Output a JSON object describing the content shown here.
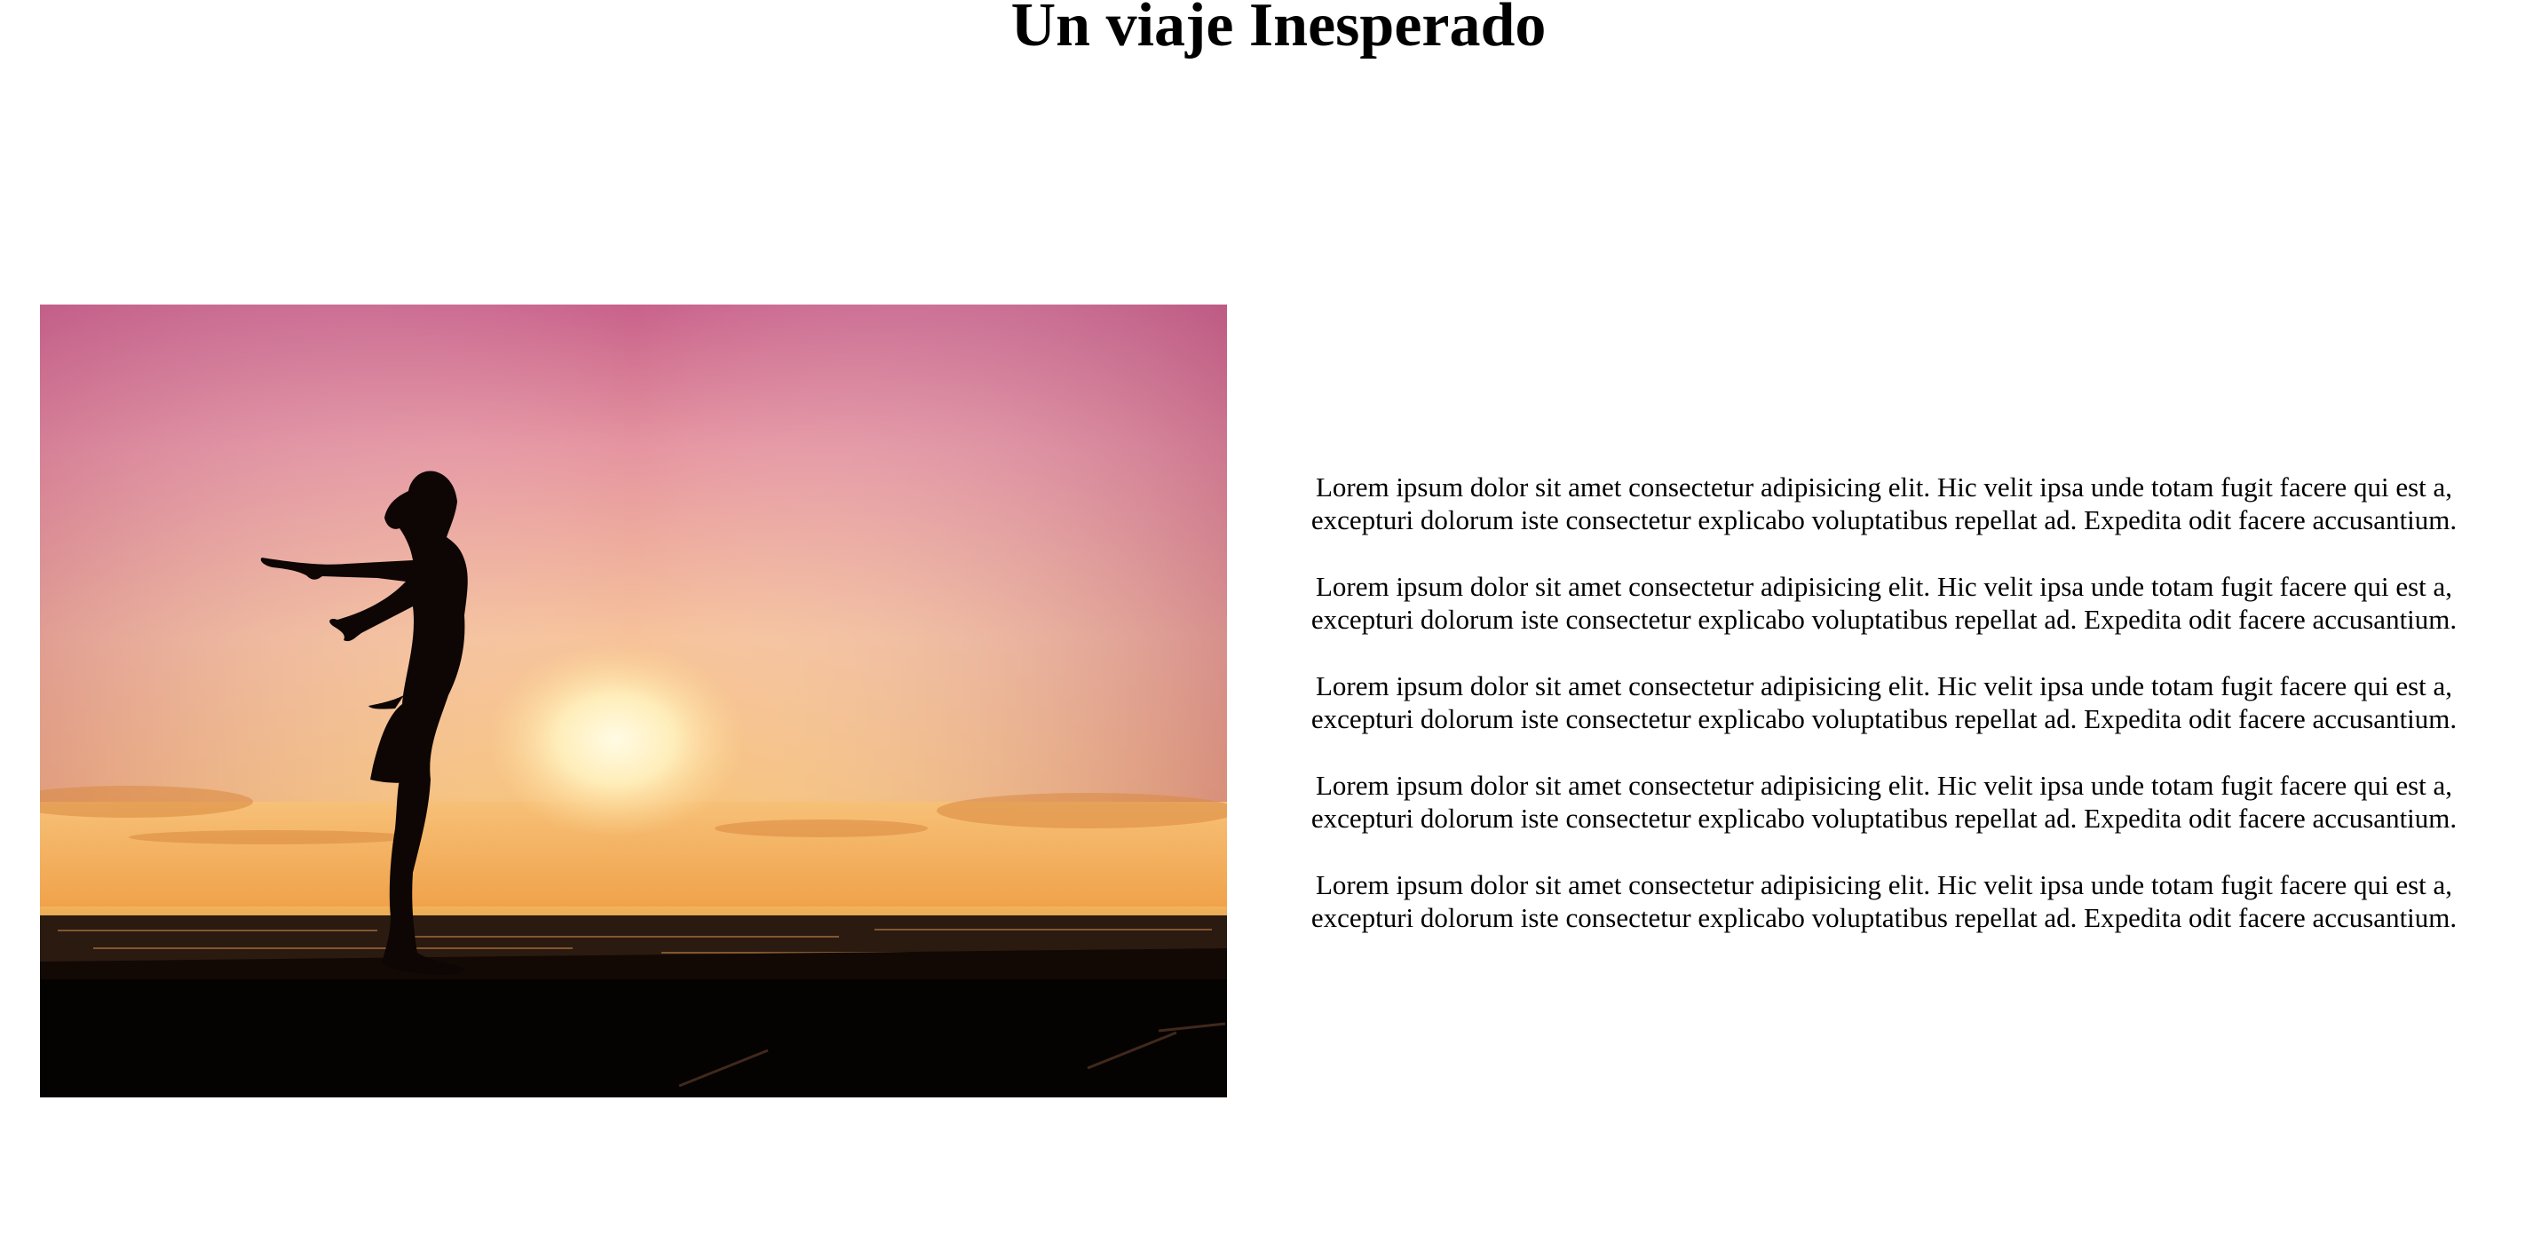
{
  "page": {
    "title": "Un viaje Inesperado"
  },
  "hero_image": {
    "subject": "woman-silhouette-sunset-beach",
    "colors": {
      "sky_top": "#c8618a",
      "sky_mid": "#f1b08c",
      "sun": "#fff3c2",
      "horizon": "#f0a24a",
      "sea": "#3a2416",
      "pier": "#0d0604"
    }
  },
  "paragraphs": [
    {
      "line1": "Lorem ipsum dolor sit amet consectetur adipisicing elit. Hic velit ipsa unde totam fugit facere qui est a,",
      "line2": "excepturi dolorum iste consectetur explicabo voluptatibus repellat ad. Expedita odit facere accusantium."
    },
    {
      "line1": "Lorem ipsum dolor sit amet consectetur adipisicing elit. Hic velit ipsa unde totam fugit facere qui est a,",
      "line2": "excepturi dolorum iste consectetur explicabo voluptatibus repellat ad. Expedita odit facere accusantium."
    },
    {
      "line1": "Lorem ipsum dolor sit amet consectetur adipisicing elit. Hic velit ipsa unde totam fugit facere qui est a,",
      "line2": "excepturi dolorum iste consectetur explicabo voluptatibus repellat ad. Expedita odit facere accusantium."
    },
    {
      "line1": "Lorem ipsum dolor sit amet consectetur adipisicing elit. Hic velit ipsa unde totam fugit facere qui est a,",
      "line2": "excepturi dolorum iste consectetur explicabo voluptatibus repellat ad. Expedita odit facere accusantium."
    },
    {
      "line1": "Lorem ipsum dolor sit amet consectetur adipisicing elit. Hic velit ipsa unde totam fugit facere qui est a,",
      "line2": "excepturi dolorum iste consectetur explicabo voluptatibus repellat ad. Expedita odit facere accusantium."
    }
  ]
}
